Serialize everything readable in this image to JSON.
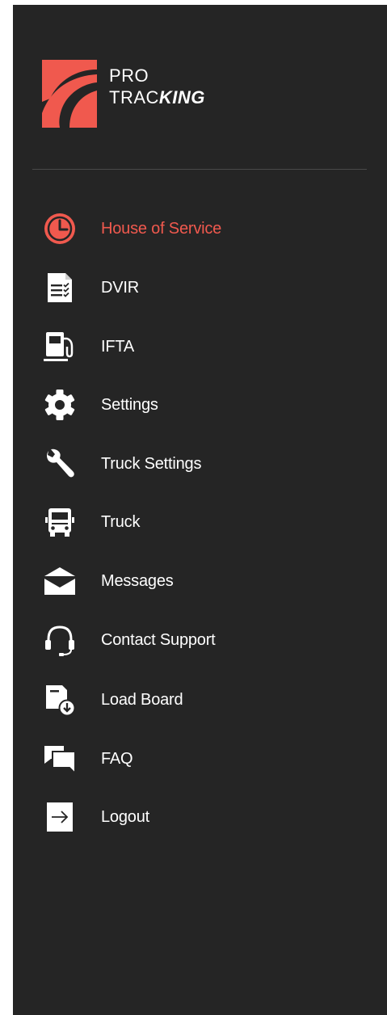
{
  "brand": {
    "line1": "PRO",
    "line2_regular": "TRAC",
    "line2_bold": "KING",
    "color": "#f0594e"
  },
  "colors": {
    "drawer_background": "#252525",
    "active": "#f0594e",
    "text": "#ffffff",
    "divider": "#4a4a4a"
  },
  "menu": {
    "active": "House of Service",
    "items": [
      {
        "label": "House of Service",
        "icon": "clock-icon"
      },
      {
        "label": "DVIR",
        "icon": "checklist-document-icon"
      },
      {
        "label": "IFTA",
        "icon": "fuel-pump-icon"
      },
      {
        "label": "Settings",
        "icon": "gear-icon"
      },
      {
        "label": "Truck Settings",
        "icon": "wrench-icon"
      },
      {
        "label": "Truck",
        "icon": "truck-icon"
      },
      {
        "label": "Messages",
        "icon": "envelope-open-icon"
      },
      {
        "label": "Contact Support",
        "icon": "headset-icon"
      },
      {
        "label": "Load Board",
        "icon": "download-box-icon"
      },
      {
        "label": "FAQ",
        "icon": "chat-bubbles-icon"
      },
      {
        "label": "Logout",
        "icon": "logout-arrow-icon"
      }
    ]
  }
}
